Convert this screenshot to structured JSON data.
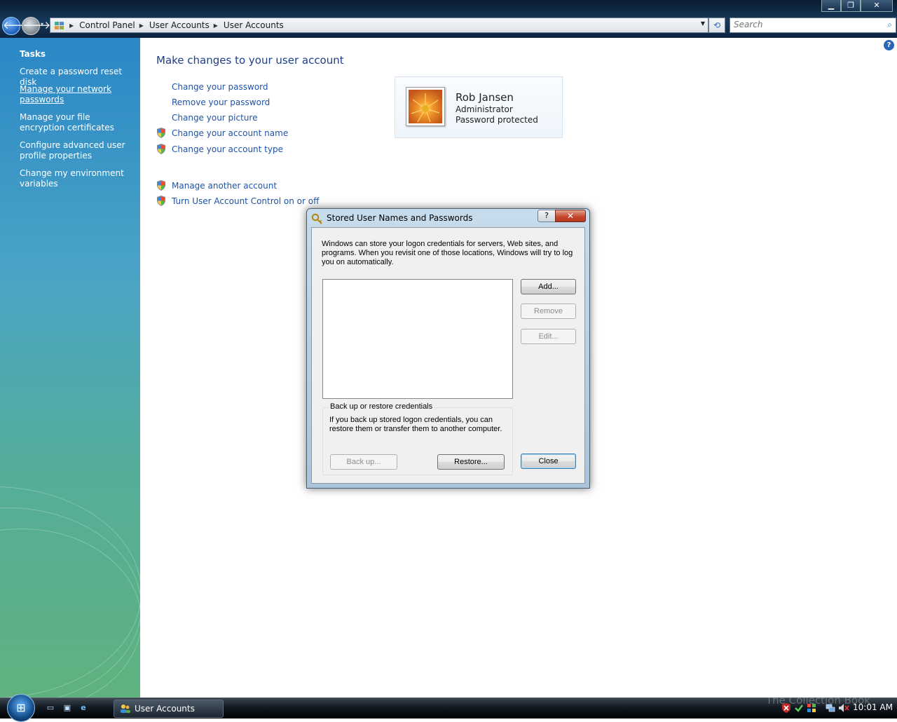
{
  "window": {
    "minimize": "▁",
    "maximize": "❐",
    "close": "✕"
  },
  "nav": {
    "back": "🡐",
    "forward": "🡒",
    "recent": "▾"
  },
  "address": {
    "crumbs": [
      "Control Panel",
      "User Accounts",
      "User Accounts"
    ],
    "separator": "▶",
    "dropdown": "▼",
    "refresh": "⟲"
  },
  "search": {
    "placeholder": "Search",
    "icon": "⌕"
  },
  "tasks": {
    "title": "Tasks",
    "items": [
      {
        "label": "Create a password reset disk"
      },
      {
        "label": "Manage your network passwords"
      },
      {
        "label": "Manage your file encryption certificates"
      },
      {
        "label": "Configure advanced user profile properties"
      },
      {
        "label": "Change my environment variables"
      }
    ]
  },
  "help_icon": "?",
  "main": {
    "title": "Make changes to your user account",
    "links": [
      {
        "label": "Change your password",
        "shield": false
      },
      {
        "label": "Remove your password",
        "shield": false
      },
      {
        "label": "Change your picture",
        "shield": false
      },
      {
        "label": "Change your account name",
        "shield": true
      },
      {
        "label": "Change your account type",
        "shield": true
      }
    ],
    "other_links": [
      {
        "label": "Manage another account",
        "shield": true
      },
      {
        "label": "Turn User Account Control on or off",
        "shield": true
      }
    ]
  },
  "account": {
    "name": "Rob Jansen",
    "role": "Administrator",
    "status": "Password protected"
  },
  "dialog": {
    "title": "Stored User Names and Passwords",
    "help_button": "?",
    "close_x": "✕",
    "description": "Windows can store your logon credentials for servers, Web sites, and programs. When you revisit one of those locations, Windows will try to log you on automatically.",
    "buttons": {
      "add": "Add...",
      "remove": "Remove",
      "edit": "Edit...",
      "backup": "Back up...",
      "restore": "Restore...",
      "close": "Close"
    },
    "backup_group": {
      "legend": "Back up or restore credentials",
      "description": "If you back up stored logon credentials, you can restore them or transfer them to another computer."
    }
  },
  "taskbar": {
    "start": "⊞",
    "quick_launch": [
      "▭",
      "▣",
      "e"
    ],
    "task_button": {
      "label": "User Accounts"
    },
    "clock": "10:01 AM",
    "watermark": "The Collection Book"
  },
  "colors": {
    "link": "#1f53a6",
    "title": "#1e3e8a",
    "pane_top": "#2b87c6",
    "pane_bottom": "#5fb27f"
  }
}
